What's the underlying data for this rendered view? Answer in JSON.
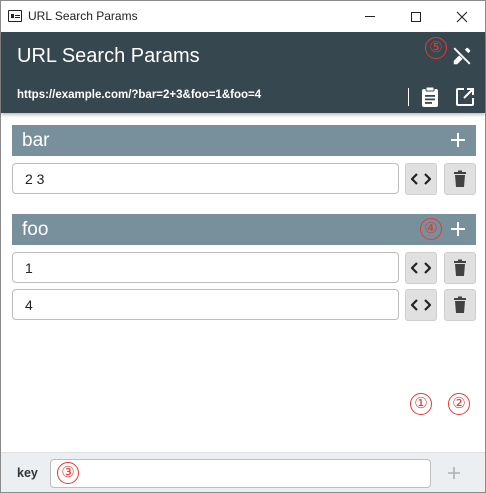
{
  "window": {
    "title": "URL Search Params"
  },
  "header": {
    "title": "URL Search Params",
    "url": "https://example.com/?bar=2+3&foo=1&foo=4"
  },
  "params": [
    {
      "name": "bar",
      "values": [
        "2 3"
      ]
    },
    {
      "name": "foo",
      "values": [
        "1",
        "4"
      ]
    }
  ],
  "footer": {
    "key_label": "key",
    "key_value": ""
  },
  "markers": [
    "①",
    "②",
    "③",
    "④",
    "⑤"
  ],
  "colors": {
    "header": "#37474f",
    "group_bar": "#78909c",
    "marker": "#e53935",
    "button_bg": "#e0e0e0"
  },
  "icons": {
    "edit_off": "edit-off-icon",
    "copy": "clipboard-icon",
    "open": "open-in-new-icon",
    "add": "plus-icon",
    "code": "code-icon",
    "delete": "trash-icon"
  }
}
